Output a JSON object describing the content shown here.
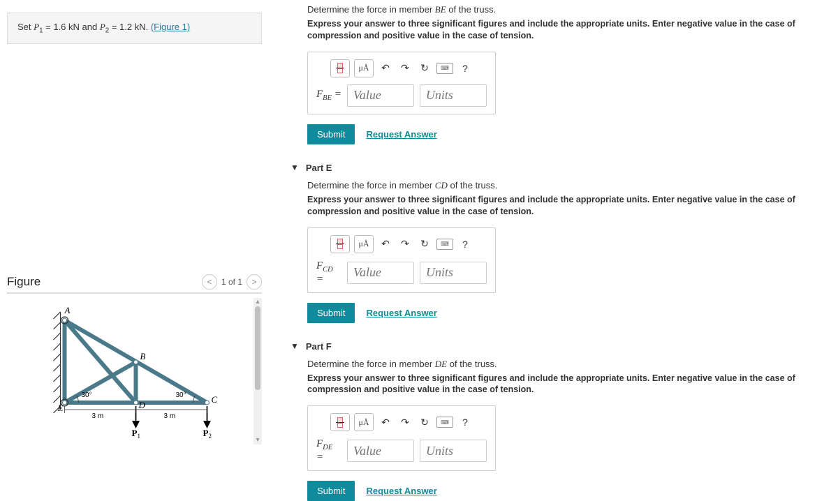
{
  "given": {
    "prefix": "Set ",
    "p1_var": "P",
    "p1_sub": "1",
    "p1_val": " = 1.6 kN",
    "and": " and ",
    "p2_var": "P",
    "p2_sub": "2",
    "p2_val": " = 1.2 kN",
    "dot": ". ",
    "figlink": "(Figure 1)"
  },
  "figure": {
    "title": "Figure",
    "pager": "1 of 1",
    "prev": "<",
    "next": ">",
    "labels": {
      "A": "A",
      "B": "B",
      "C": "C",
      "D": "D",
      "E": "E",
      "ang1": "30°",
      "ang2": "30°",
      "d1": "3 m",
      "d2": "3 m",
      "P1": "P",
      "P1s": "1",
      "P2": "P",
      "P2s": "2"
    }
  },
  "partD": {
    "prompt_a": "Determine the force in member ",
    "member": "BE",
    "prompt_b": " of the truss.",
    "instr": "Express your answer to three significant figures and include the appropriate units. Enter negative value in the case of compression and positive value in the case of tension.",
    "fvar": "F",
    "fsub": "BE",
    "eq": " =",
    "value_ph": "Value",
    "units_ph": "Units",
    "submit": "Submit",
    "req": "Request Answer"
  },
  "partE": {
    "title": "Part E",
    "prompt_a": "Determine the force in member ",
    "member": "CD",
    "prompt_b": " of the truss.",
    "instr": "Express your answer to three significant figures and include the appropriate units. Enter negative value in the case of compression and positive value in the case of tension.",
    "fvar": "F",
    "fsub": "CD",
    "eq": " =",
    "value_ph": "Value",
    "units_ph": "Units",
    "submit": "Submit",
    "req": "Request Answer"
  },
  "partF": {
    "title": "Part F",
    "prompt_a": "Determine the force in member ",
    "member": "DE",
    "prompt_b": " of the truss.",
    "instr": "Express your answer to three significant figures and include the appropriate units. Enter negative value in the case of compression and positive value in the case of tension.",
    "fvar": "F",
    "fsub": "DE",
    "eq": " =",
    "value_ph": "Value",
    "units_ph": "Units",
    "submit": "Submit",
    "req": "Request Answer"
  },
  "toolbar": {
    "mu": "μÅ",
    "undo": "↶",
    "redo": "↷",
    "reset": "↻",
    "help": "?"
  }
}
